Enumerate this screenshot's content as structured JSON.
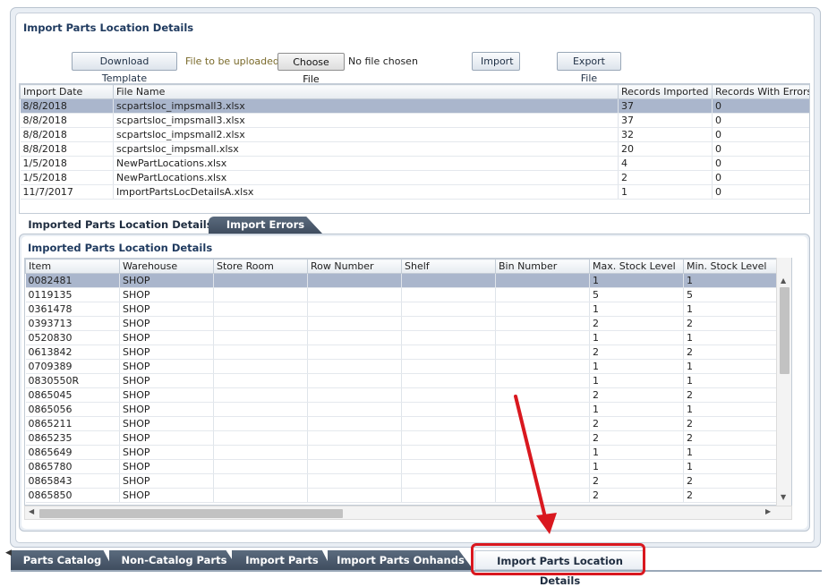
{
  "top_section": {
    "title": "Import Parts Location Details",
    "download_button": "Download Template",
    "upload_label": "File to be uploaded",
    "choose_file_button": "Choose File",
    "no_file_text": "No file chosen",
    "import_button": "Import",
    "export_button": "Export File"
  },
  "imports_table": {
    "columns": [
      "Import Date",
      "File Name",
      "Records Imported",
      "Records With Errors"
    ],
    "rows": [
      {
        "date": "8/8/2018",
        "file": "scpartsloc_impsmall3.xlsx",
        "imported": "37",
        "errors": "0",
        "selected": true
      },
      {
        "date": "8/8/2018",
        "file": "scpartsloc_impsmall3.xlsx",
        "imported": "37",
        "errors": "0"
      },
      {
        "date": "8/8/2018",
        "file": "scpartsloc_impsmall2.xlsx",
        "imported": "32",
        "errors": "0"
      },
      {
        "date": "8/8/2018",
        "file": "scpartsloc_impsmall.xlsx",
        "imported": "20",
        "errors": "0"
      },
      {
        "date": "1/5/2018",
        "file": "NewPartLocations.xlsx",
        "imported": "4",
        "errors": "0"
      },
      {
        "date": "1/5/2018",
        "file": "NewPartLocations.xlsx",
        "imported": "2",
        "errors": "0"
      },
      {
        "date": "11/7/2017",
        "file": "ImportPartsLocDetailsA.xlsx",
        "imported": "1",
        "errors": "0"
      }
    ]
  },
  "inner_tabs": {
    "imported": "Imported Parts Location Details",
    "errors": "Import Errors"
  },
  "parts_section": {
    "title": "Imported Parts Location Details",
    "columns": [
      "Item",
      "Warehouse",
      "Store Room",
      "Row Number",
      "Shelf",
      "Bin Number",
      "Max. Stock Level",
      "Min. Stock Level"
    ],
    "rows": [
      {
        "item": "0082481",
        "warehouse": "SHOP",
        "max": "1",
        "min": "1",
        "selected": true
      },
      {
        "item": "0119135",
        "warehouse": "SHOP",
        "max": "5",
        "min": "5"
      },
      {
        "item": "0361478",
        "warehouse": "SHOP",
        "max": "1",
        "min": "1"
      },
      {
        "item": "0393713",
        "warehouse": "SHOP",
        "max": "2",
        "min": "2"
      },
      {
        "item": "0520830",
        "warehouse": "SHOP",
        "max": "1",
        "min": "1"
      },
      {
        "item": "0613842",
        "warehouse": "SHOP",
        "max": "2",
        "min": "2"
      },
      {
        "item": "0709389",
        "warehouse": "SHOP",
        "max": "1",
        "min": "1"
      },
      {
        "item": "0830550R",
        "warehouse": "SHOP",
        "max": "1",
        "min": "1"
      },
      {
        "item": "0865045",
        "warehouse": "SHOP",
        "max": "2",
        "min": "2"
      },
      {
        "item": "0865056",
        "warehouse": "SHOP",
        "max": "1",
        "min": "1"
      },
      {
        "item": "0865211",
        "warehouse": "SHOP",
        "max": "2",
        "min": "2"
      },
      {
        "item": "0865235",
        "warehouse": "SHOP",
        "max": "2",
        "min": "2"
      },
      {
        "item": "0865649",
        "warehouse": "SHOP",
        "max": "1",
        "min": "1"
      },
      {
        "item": "0865780",
        "warehouse": "SHOP",
        "max": "1",
        "min": "1"
      },
      {
        "item": "0865843",
        "warehouse": "SHOP",
        "max": "2",
        "min": "2"
      },
      {
        "item": "0865850",
        "warehouse": "SHOP",
        "max": "2",
        "min": "2"
      }
    ]
  },
  "bottom_tabs": {
    "catalog": "Parts Catalog",
    "noncatalog": "Non-Catalog Parts",
    "import": "Import Parts",
    "onhands": "Import Parts Onhands",
    "location": "Import Parts Location Details"
  },
  "colors": {
    "selected_row": "#aab6cc",
    "tab_dark": "#4a5a6d",
    "title_blue": "#1f3a5f",
    "annotation_red": "#d9181f"
  }
}
